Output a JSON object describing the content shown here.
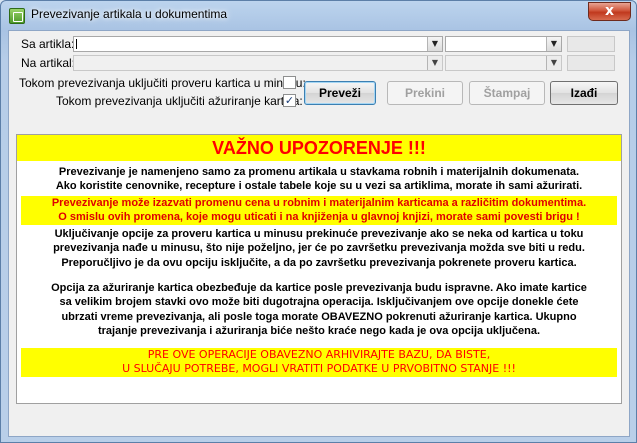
{
  "window": {
    "title": "Prevezivanje artikala u dokumentima",
    "close_glyph": "x"
  },
  "form": {
    "sa_artikla_label": "Sa artikla:",
    "na_artikal_label": "Na artikal:",
    "check_minus_label": "Tokom prevezivanja uključiti proveru kartica u minusu:",
    "check_minus_checked": false,
    "check_update_label": "Tokom prevezivanja uključiti ažuriranje kartica:",
    "check_update_checked": true,
    "check_mark": "✓",
    "dropdown_glyph": "▼"
  },
  "buttons": {
    "prevezi": "Preveži",
    "prekini": "Prekini",
    "stampaj": "Štampaj",
    "izadji": "Izađi"
  },
  "warning": {
    "title": "VAŽNO UPOZORENJE !!!",
    "p1_line1": "Prevezivanje je namenjeno samo za promenu artikala u stavkama robnih i materijalnih dokumenata.",
    "p1_line2": "Ako koristite cenovnike, recepture i ostale tabele koje su u vezi sa artiklima, morate ih sami ažurirati.",
    "p2_line1": "Prevezivanje može izazvati promenu cena u robnim i materijalnim karticama a različitim dokumentima.",
    "p2_line2": "O smislu ovih promena, koje mogu uticati i na knjiženja u glavnoj knjizi, morate sami povesti brigu !",
    "p3_line1": "Uključivanje opcije za proveru kartica u minusu prekinuće prevezivanje ako se neka od kartica u toku",
    "p3_line2": "prevezivanja nađe u minusu, što nije poželjno, jer će po završetku prevezivanja možda sve biti u redu.",
    "p3_line3": "Preporučljivo je da ovu opciju isključite, a da po završetku prevezivanja pokrenete proveru kartica.",
    "p4_line1": "Opcija za ažuriranje kartica obezbeđuje da kartice posle prevezivanja budu ispravne. Ako imate kartice",
    "p4_line2": "sa velikim brojem stavki ovo može biti dugotrajna operacija. Isključivanjem ove opcije donekle ćete",
    "p4_line3": "ubrzati vreme prevezivanja, ali posle toga morate OBAVEZNO pokrenuti ažuriranje kartica. Ukupno",
    "p4_line4": "trajanje prevezivanja i ažuriranja biće nešto kraće nego kada je ova opcija uključena.",
    "p5_line1": "PRE OVE OPERACIJE OBAVEZNO ARHIVIRAJTE BAZU, DA BISTE,",
    "p5_line2": "U SLUČAJU POTREBE, MOGLI VRATITI PODATKE U PRVOBITNO STANJE !!!"
  }
}
